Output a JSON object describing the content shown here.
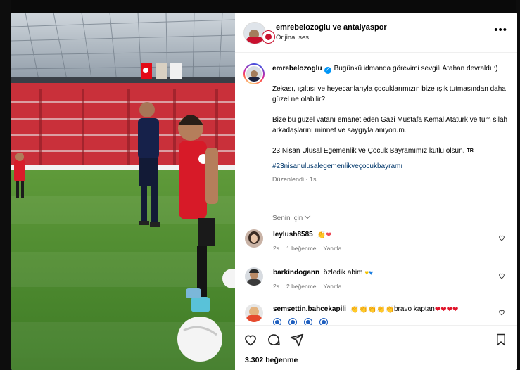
{
  "post": {
    "header": {
      "title": "emrebelozoglu ve antalyaspor",
      "subtitle": "Orijinal ses",
      "more_label": "•••"
    },
    "caption": {
      "username": "emrebelozoglu",
      "line1": "Bugünkü idmanda görevimi sevgili Atahan devraldı :)",
      "para2": "Zekası, ışıltısı ve heyecanlarıyla çocuklarımızın bize ışık tutmasından daha güzel ne olabilir?",
      "para3": "Bize bu güzel vatanı emanet eden Gazi Mustafa Kemal Atatürk ve tüm silah arkadaşlarını minnet ve saygıyla anıyorum.",
      "para4": "23 Nisan Ulusal Egemenlik ve Çocuk Bayramımız kutlu olsun.",
      "flag_text": "TR",
      "hashtag": "#23nisanulusalegemenlikveçocukbayramı",
      "edited": "Düzenlendi",
      "time": "1s"
    },
    "for_you_label": "Senin için",
    "comments": [
      {
        "username": "leylush8585",
        "text": "",
        "time": "2s",
        "likes": "1 beğenme",
        "reply": "Yanıtla"
      },
      {
        "username": "barkindogann",
        "text": "özledik abim",
        "time": "2s",
        "likes": "2 beğenme",
        "reply": "Yanıtla"
      },
      {
        "username": "semsettin.bahcekapili",
        "text": "bravo kaptan",
        "time": "",
        "likes": "",
        "reply": ""
      }
    ],
    "likes_count": "3.302 beğenme"
  },
  "colors": {
    "accent": "#0095f6",
    "heart_red": "#ed4956",
    "link": "#00376b",
    "muted": "#737373"
  }
}
